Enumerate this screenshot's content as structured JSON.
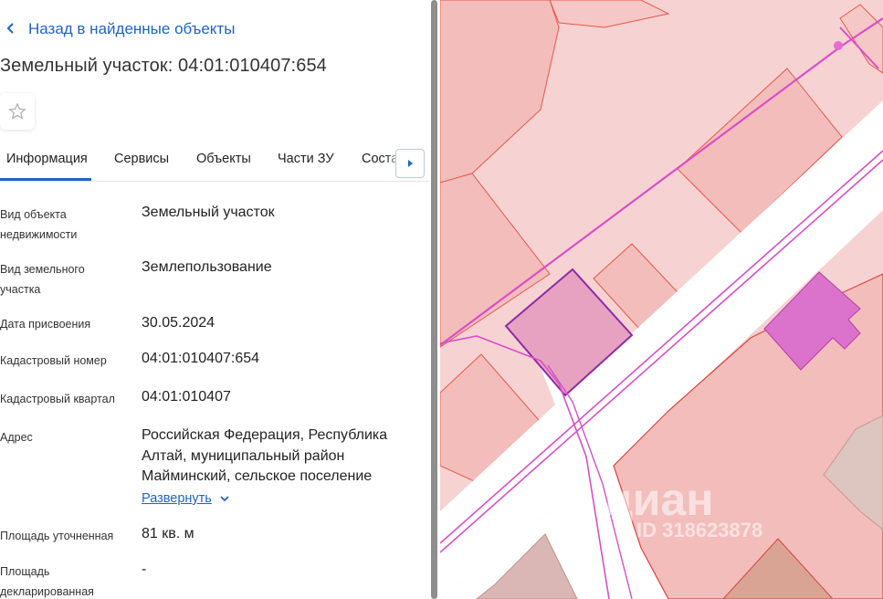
{
  "nav": {
    "back_label": "Назад в найденные объекты"
  },
  "object": {
    "title": "Земельный участок: 04:01:010407:654"
  },
  "tabs": [
    {
      "label": "Информация"
    },
    {
      "label": "Сервисы"
    },
    {
      "label": "Объекты"
    },
    {
      "label": "Части ЗУ"
    },
    {
      "label": "Составные ЗУ"
    }
  ],
  "details": {
    "type_label": "Вид объекта недвижимости",
    "type_value": "Земельный участок",
    "land_type_label": "Вид земельного участка",
    "land_type_value": "Землепользование",
    "date_label": "Дата присвоения",
    "date_value": "30.05.2024",
    "cad_number_label": "Кадастровый номер",
    "cad_number_value": "04:01:010407:654",
    "cad_quarter_label": "Кадастровый квартал",
    "cad_quarter_value": "04:01:010407",
    "address_label": "Адрес",
    "address_value": "Российская Федерация, Республика Алтай, муниципальный район Майминский, сельское поселение",
    "expand_label": "Развернуть",
    "area_label": "Площадь уточненная",
    "area_value": "81 кв. м",
    "declared_label": "Площадь декларированная",
    "declared_value": "-"
  },
  "watermark": {
    "brand": "циан",
    "id": "ID 318623878"
  },
  "colors": {
    "accent": "#1d64c8",
    "parcel_fill": "#f2bcbb",
    "parcel_border": "#e24b3a",
    "selected_fill": "#e4a2c0",
    "selected_border": "#8e2aa6",
    "building": "#db73cc",
    "line": "#d94fc7"
  }
}
